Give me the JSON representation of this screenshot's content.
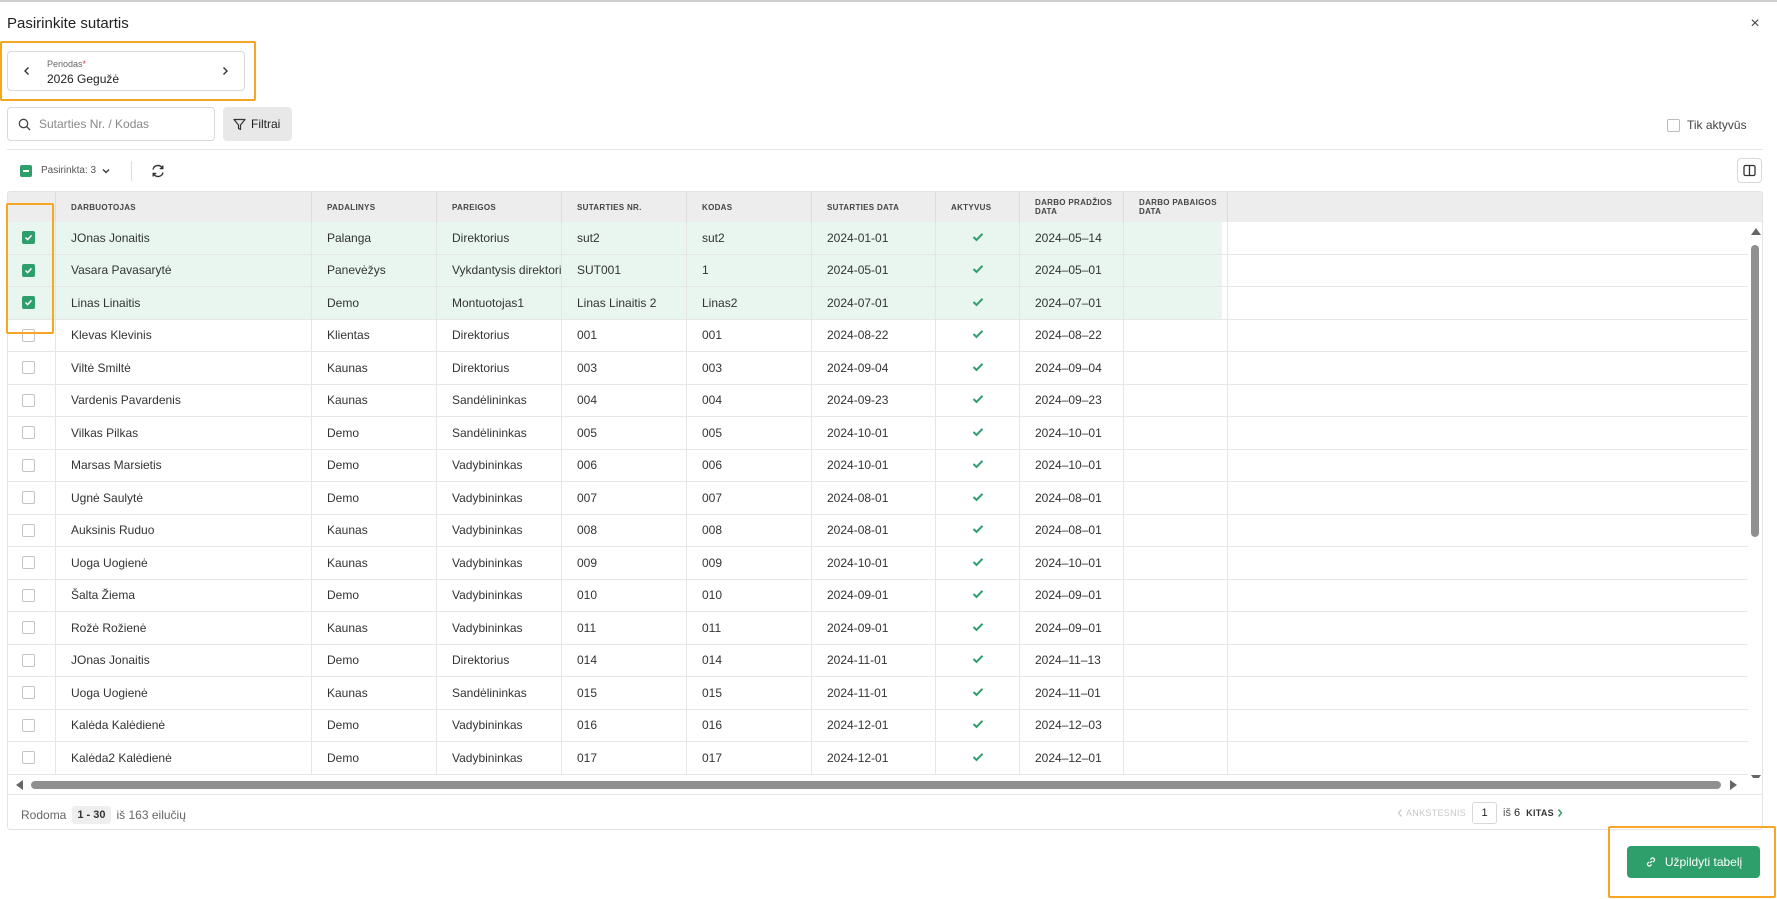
{
  "dialog": {
    "title": "Pasirinkite sutartis",
    "close_symbol": "×"
  },
  "period": {
    "label": "Periodas",
    "required_mark": "*",
    "value": "2026 Gegužė"
  },
  "search": {
    "placeholder": "Sutarties Nr. / Kodas",
    "value": ""
  },
  "filters": {
    "label": "Filtrai"
  },
  "only_active": {
    "label": "Tik aktyvūs",
    "checked": false
  },
  "selection": {
    "label": "Pasirinkta: 3"
  },
  "table": {
    "columns": [
      "Darbuotojas",
      "Padalinys",
      "Pareigos",
      "Sutarties Nr.",
      "Kodas",
      "Sutarties data",
      "Aktyvus",
      "Darbo pradžios data",
      "Darbo pabaigos data"
    ],
    "rows": [
      {
        "selected": true,
        "employee": "JOnas Jonaitis",
        "division": "Palanga",
        "position": "Direktorius",
        "contract_no": "sut2",
        "code": "sut2",
        "contract_date": "2024-01-01",
        "active": true,
        "start": "2024–05–14",
        "end": ""
      },
      {
        "selected": true,
        "employee": "Vasara Pavasarytė",
        "division": "Panevėžys",
        "position": "Vykdantysis direktorius",
        "contract_no": "SUT001",
        "code": "1",
        "contract_date": "2024-05-01",
        "active": true,
        "start": "2024–05–01",
        "end": ""
      },
      {
        "selected": true,
        "employee": "Linas Linaitis",
        "division": "Demo",
        "position": "Montuotojas1",
        "contract_no": "Linas Linaitis 2",
        "code": "Linas2",
        "contract_date": "2024-07-01",
        "active": true,
        "start": "2024–07–01",
        "end": ""
      },
      {
        "selected": false,
        "employee": "Klevas Klevinis",
        "division": "Klientas",
        "position": "Direktorius",
        "contract_no": "001",
        "code": "001",
        "contract_date": "2024-08-22",
        "active": true,
        "start": "2024–08–22",
        "end": ""
      },
      {
        "selected": false,
        "employee": "Viltė Smiltė",
        "division": "Kaunas",
        "position": "Direktorius",
        "contract_no": "003",
        "code": "003",
        "contract_date": "2024-09-04",
        "active": true,
        "start": "2024–09–04",
        "end": ""
      },
      {
        "selected": false,
        "employee": "Vardenis Pavardenis",
        "division": "Kaunas",
        "position": "Sandėlininkas",
        "contract_no": "004",
        "code": "004",
        "contract_date": "2024-09-23",
        "active": true,
        "start": "2024–09–23",
        "end": ""
      },
      {
        "selected": false,
        "employee": "Vilkas Pilkas",
        "division": "Demo",
        "position": "Sandėlininkas",
        "contract_no": "005",
        "code": "005",
        "contract_date": "2024-10-01",
        "active": true,
        "start": "2024–10–01",
        "end": ""
      },
      {
        "selected": false,
        "employee": "Marsas Marsietis",
        "division": "Demo",
        "position": "Vadybininkas",
        "contract_no": "006",
        "code": "006",
        "contract_date": "2024-10-01",
        "active": true,
        "start": "2024–10–01",
        "end": ""
      },
      {
        "selected": false,
        "employee": "Ugnė Saulytė",
        "division": "Demo",
        "position": "Vadybininkas",
        "contract_no": "007",
        "code": "007",
        "contract_date": "2024-08-01",
        "active": true,
        "start": "2024–08–01",
        "end": ""
      },
      {
        "selected": false,
        "employee": "Auksinis Ruduo",
        "division": "Kaunas",
        "position": "Vadybininkas",
        "contract_no": "008",
        "code": "008",
        "contract_date": "2024-08-01",
        "active": true,
        "start": "2024–08–01",
        "end": ""
      },
      {
        "selected": false,
        "employee": "Uoga Uogienė",
        "division": "Kaunas",
        "position": "Vadybininkas",
        "contract_no": "009",
        "code": "009",
        "contract_date": "2024-10-01",
        "active": true,
        "start": "2024–10–01",
        "end": ""
      },
      {
        "selected": false,
        "employee": "Šalta Žiema",
        "division": "Demo",
        "position": "Vadybininkas",
        "contract_no": "010",
        "code": "010",
        "contract_date": "2024-09-01",
        "active": true,
        "start": "2024–09–01",
        "end": ""
      },
      {
        "selected": false,
        "employee": "Rožė Rožienė",
        "division": "Kaunas",
        "position": "Vadybininkas",
        "contract_no": "011",
        "code": "011",
        "contract_date": "2024-09-01",
        "active": true,
        "start": "2024–09–01",
        "end": ""
      },
      {
        "selected": false,
        "employee": "JOnas Jonaitis",
        "division": "Demo",
        "position": "Direktorius",
        "contract_no": "014",
        "code": "014",
        "contract_date": "2024-11-01",
        "active": true,
        "start": "2024–11–13",
        "end": ""
      },
      {
        "selected": false,
        "employee": "Uoga Uogienė",
        "division": "Kaunas",
        "position": "Sandėlininkas",
        "contract_no": "015",
        "code": "015",
        "contract_date": "2024-11-01",
        "active": true,
        "start": "2024–11–01",
        "end": ""
      },
      {
        "selected": false,
        "employee": "Kalėda Kalėdienė",
        "division": "Demo",
        "position": "Vadybininkas",
        "contract_no": "016",
        "code": "016",
        "contract_date": "2024-12-01",
        "active": true,
        "start": "2024–12–03",
        "end": ""
      },
      {
        "selected": false,
        "employee": "Kalėda2 Kalėdienė",
        "division": "Demo",
        "position": "Vadybininkas",
        "contract_no": "017",
        "code": "017",
        "contract_date": "2024-12-01",
        "active": true,
        "start": "2024–12–01",
        "end": ""
      }
    ]
  },
  "footer": {
    "shown_label": "Rodoma",
    "range": "1 - 30",
    "total_label": "iš 163 eilučių"
  },
  "pagination": {
    "prev_label": "ANKSTESNIS",
    "current_page": "1",
    "of_label": "iš",
    "total_pages": "6",
    "next_label": "KITAS"
  },
  "actions": {
    "fill_label": "Užpildyti tabelį"
  },
  "colors": {
    "accent": "#2e9e6b",
    "highlight": "#f5a623",
    "selected_row": "#e8f6ef"
  }
}
